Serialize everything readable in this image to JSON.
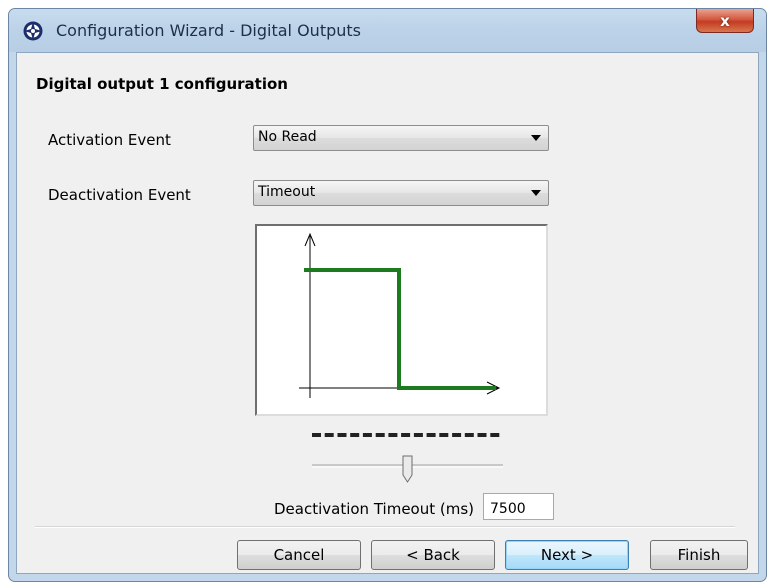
{
  "window": {
    "title": "Configuration Wizard - Digital Outputs",
    "icons": {
      "app": "app-compass-icon",
      "close": "close-icon"
    },
    "close_glyph": "x"
  },
  "content": {
    "heading": "Digital output 1 configuration",
    "activation": {
      "label": "Activation Event",
      "value": "No Read"
    },
    "deactivation": {
      "label": "Deactivation Event",
      "value": "Timeout"
    },
    "graph": {
      "line_color": "#1e7a1e",
      "signal": "high-then-low step"
    },
    "slider": {
      "position": 0.5
    },
    "timeout": {
      "label": "Deactivation Timeout (ms)",
      "value": "7500"
    }
  },
  "buttons": {
    "cancel": "Cancel",
    "back": "< Back",
    "next": "Next >",
    "finish": "Finish"
  },
  "colors": {
    "frame": "#c3d7ea",
    "client": "#f0f0f0",
    "close": "#c33b22",
    "default_button": "#3c7fb1"
  }
}
